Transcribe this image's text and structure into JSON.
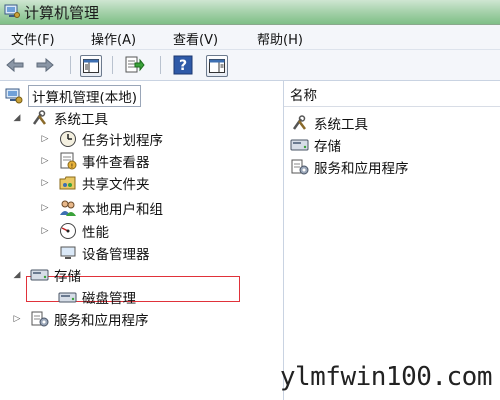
{
  "window": {
    "title": "计算机管理"
  },
  "menu": [
    "文件(F)",
    "操作(A)",
    "查看(V)",
    "帮助(H)"
  ],
  "toolbar": {
    "icons": [
      "back-arrow-icon",
      "forward-arrow-icon",
      "console-tree-icon",
      "export-list-icon",
      "help-icon",
      "action-pane-icon"
    ]
  },
  "tree": {
    "root": "计算机管理(本地)",
    "system_tools": "系统工具",
    "task_scheduler": "任务计划程序",
    "event_viewer": "事件查看器",
    "shared_folders": "共享文件夹",
    "local_users_groups": "本地用户和组",
    "performance": "性能",
    "device_manager": "设备管理器",
    "storage": "存储",
    "disk_management": "磁盘管理",
    "services_apps": "服务和应用程序"
  },
  "right_pane": {
    "column_header": "名称",
    "items": [
      "系统工具",
      "存储",
      "服务和应用程序"
    ]
  },
  "highlight_color": "#e0323a",
  "watermark": "ylmfwin100.com"
}
